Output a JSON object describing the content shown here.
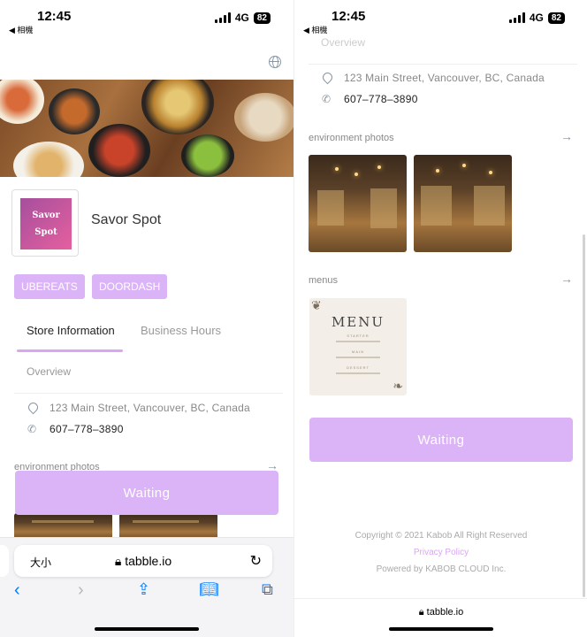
{
  "status_bar": {
    "time": "12:45",
    "back_label": "◀ 相機",
    "network": "4G",
    "battery": "82"
  },
  "hero": {
    "alt": "food photo"
  },
  "store": {
    "logo_line1": "Savor",
    "logo_line2": "Spot",
    "name": "Savor Spot"
  },
  "tags": [
    "UBEREATS",
    "DOORDASH"
  ],
  "tabs": {
    "active": "Store Information",
    "inactive": "Business Hours"
  },
  "overview_label": "Overview",
  "info": {
    "address": "123 Main Street, Vancouver, BC, Canada",
    "phone": "607–778–3890"
  },
  "sections": {
    "photos": "environment photos",
    "menus": "menus"
  },
  "waiting_button": "Waiting",
  "menu_card": {
    "title": "MENU",
    "starter": "STARTER",
    "main": "MAIN",
    "dessert": "DESSERT"
  },
  "footer": {
    "copyright": "Copyright © 2021 Kabob All Right Reserved",
    "privacy": "Privacy Policy",
    "powered": "Powered by KABOB CLOUD Inc."
  },
  "safari": {
    "aa_label": "大小",
    "url": "tabble.io"
  },
  "colors": {
    "accent": "#dbb3f7",
    "accent_strong": "#d9a6f4",
    "ios_blue": "#007aff"
  }
}
